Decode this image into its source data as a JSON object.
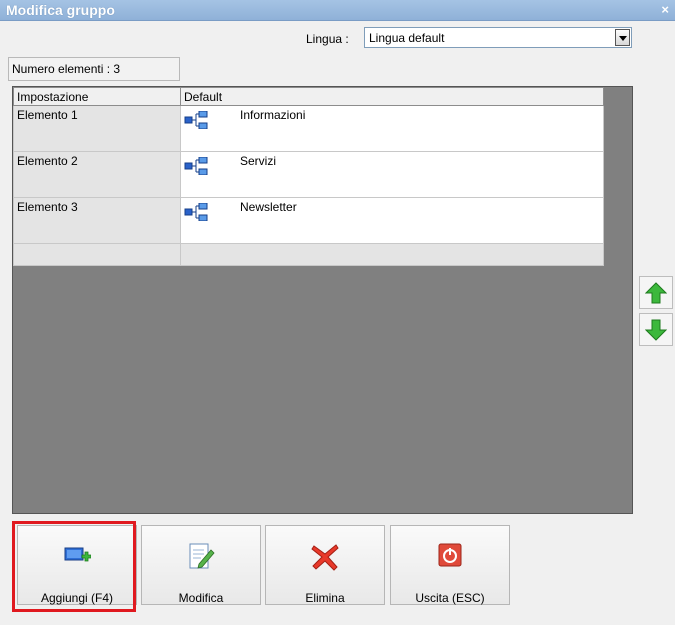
{
  "window": {
    "title": "Modifica gruppo",
    "close_glyph": "×"
  },
  "language": {
    "label": "Lingua :",
    "selected": "Lingua default"
  },
  "count_label": "Numero elementi : 3",
  "table": {
    "headers": [
      "Impostazione",
      "Default"
    ],
    "rows": [
      {
        "name": "Elemento 1",
        "value": "Informazioni",
        "icon": "hierarchy-icon"
      },
      {
        "name": "Elemento 2",
        "value": "Servizi",
        "icon": "hierarchy-icon"
      },
      {
        "name": "Elemento 3",
        "value": "Newsletter",
        "icon": "hierarchy-icon"
      }
    ]
  },
  "side_buttons": {
    "up_icon": "arrow-up-icon",
    "down_icon": "arrow-down-icon"
  },
  "buttons": {
    "add": "Aggiungi (F4)",
    "edit": "Modifica",
    "delete": "Elimina",
    "exit": "Uscita (ESC)"
  },
  "colors": {
    "titlebar": "#9bbbe0",
    "highlight": "#e0191f",
    "grid_bg": "#808080",
    "arrow_green": "#3cb83c"
  }
}
